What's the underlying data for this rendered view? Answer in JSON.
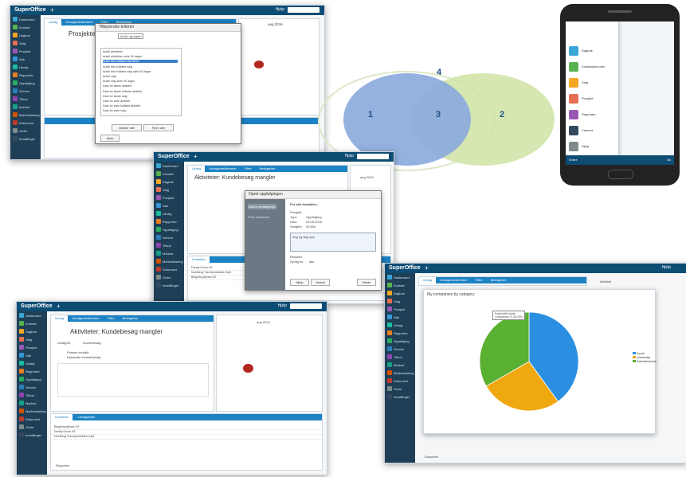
{
  "app": {
    "name": "SuperOffice",
    "help": "Hjelp"
  },
  "nav_labels": [
    "Dashboard",
    "Kontakt",
    "Dagbok",
    "Salg",
    "Prosjekt",
    "Søk",
    "Utvalg",
    "Rapporter",
    "Oppfølging",
    "Service",
    "Tilbud",
    "Marked",
    "Markedsføring",
    "Dokument",
    "Ordre",
    "Innstillinger"
  ],
  "nav_colors": [
    "#3aa6d8",
    "#58b34f",
    "#f4a623",
    "#e76f51",
    "#9b59b6",
    "#3498db",
    "#1abc9c",
    "#e67e22",
    "#27ae60",
    "#2980b9",
    "#8e44ad",
    "#16a085",
    "#d35400",
    "#c0392b",
    "#7f8c8d",
    "#34495e"
  ],
  "tabs": [
    "Utvalg",
    "Utvalgsmedlemmer",
    "Filtre",
    "Betingelser"
  ],
  "screen1": {
    "title": "Prosjekter: Alle i",
    "dialog_title": "Tilføy/endre kriterier",
    "dialog_items": [
      "Antall aktiviteter",
      "Antall aktiviteter siste 90 dager",
      "Antall ikke fullførte aktiviteter",
      "Antall ikke fullførte salg",
      "Antall ikke fullførte salg siste 90 dager",
      "Antall salg",
      "Antall salg siste 90 dager",
      "Dato for første aktivitet",
      "Dato for første fullførte aktivitet",
      "Dato for første salg",
      "Dato for siste aktivitet",
      "Dato for siste fullførte aktivitet",
      "Dato for siste salg"
    ],
    "dialog_select": "Andre grupperi",
    "dialog_buttons": [
      "Marker alle",
      "Fjern alle"
    ],
    "help_btn": "Hjelp",
    "month": "aug 2016"
  },
  "screen2": {
    "title": "Aktiviteter: Kundebesøg mangler",
    "dialog_title": "Opret oppfølgingen",
    "steps": [
      "Aktive oppfølginger",
      "Flere aktiviteter"
    ],
    "heading": "For alle kontakter...",
    "fields": [
      "Prosjekt",
      "Type",
      "Dato",
      "Varighet"
    ],
    "type_val": "Oppfølging",
    "date_val": "25.05.2016",
    "dur_val": "30 Min",
    "note": "ring og følg opp",
    "result_label": "Resultat",
    "status_label": "Synlig for",
    "status_val": "alle",
    "buttons": [
      "Hjelp",
      "Avbryt",
      "Neste"
    ],
    "month": "aug 2016",
    "contacts_tab": "Kontakter",
    "rows": [
      "Dandy Grovn AS",
      "Nordberg Travelproduktion ApS",
      "Belgiehuytjenes US"
    ]
  },
  "screen3": {
    "title": "Aktiviteter: Kundebesøg mangler",
    "labels": [
      "Utvalg/ID",
      "Kundebesøg",
      "Primær kontakt",
      "Dynamisk kontaktutvalg"
    ],
    "bottom_tabs": [
      "Kontakter",
      "Utvalgslinjer"
    ],
    "rows": [
      "Belgiehuytjenes US",
      "Dandy Grovn AS",
      "Nordberg Travelproduktion ApS"
    ],
    "footer": "Eksporter",
    "month": "aug 2016"
  },
  "screen4": {
    "title": "My companies by category",
    "legend": [
      "Kunde",
      "Leverandør",
      "Potensiell kunde"
    ],
    "tooltip_title": "Potensiell kunde",
    "tooltip_text": "Companies: 5 (33.3%)",
    "footer": "Eksporter",
    "sidebar_label": "Aktivitet"
  },
  "venn": {
    "labels": [
      "1",
      "3",
      "2",
      "4"
    ]
  },
  "phone": {
    "items": [
      "Dagbok",
      "Kontaktpersoner",
      "Salg",
      "Prosjekt",
      "Rapporter",
      "Camera",
      "Hjelp"
    ],
    "colors": [
      "#3aa6d8",
      "#58b34f",
      "#f4a623",
      "#e76f51",
      "#9b59b6",
      "#34495e",
      "#7f8c8d"
    ],
    "footer_left": "Endre",
    "footer_right": "Ok"
  },
  "chart_data": {
    "type": "pie",
    "title": "My companies by category",
    "categories": [
      "Kunde",
      "Leverandør",
      "Potensiell kunde"
    ],
    "values": [
      40,
      26.7,
      33.3
    ],
    "colors": [
      "#2a8fe0",
      "#f0a810",
      "#5ab031"
    ]
  }
}
